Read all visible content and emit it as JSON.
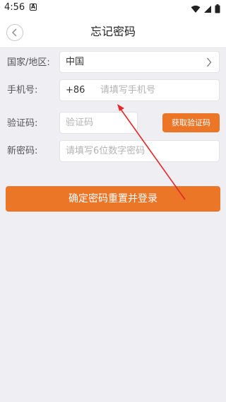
{
  "status_bar": {
    "time": "4:56",
    "notification_glyph": "A",
    "icons": [
      "wifi-icon",
      "signal-icon",
      "battery-icon"
    ]
  },
  "header": {
    "title": "忘记密码",
    "back_icon": "chevron-left-icon"
  },
  "form": {
    "country": {
      "label": "国家/地区:",
      "value": "中国",
      "icon": "chevron-right-icon"
    },
    "phone": {
      "label": "手机号:",
      "prefix": "+86",
      "placeholder": "请填写手机号"
    },
    "code": {
      "label": "验证码:",
      "placeholder": "验证码",
      "button_label": "获取验证码"
    },
    "new_password": {
      "label": "新密码:",
      "placeholder": "请填写6位数字密码"
    }
  },
  "actions": {
    "submit_label": "确定密码重置并登录"
  },
  "colors": {
    "accent": "#ec7628",
    "background": "#efeef3",
    "annotation": "#e5262a"
  }
}
